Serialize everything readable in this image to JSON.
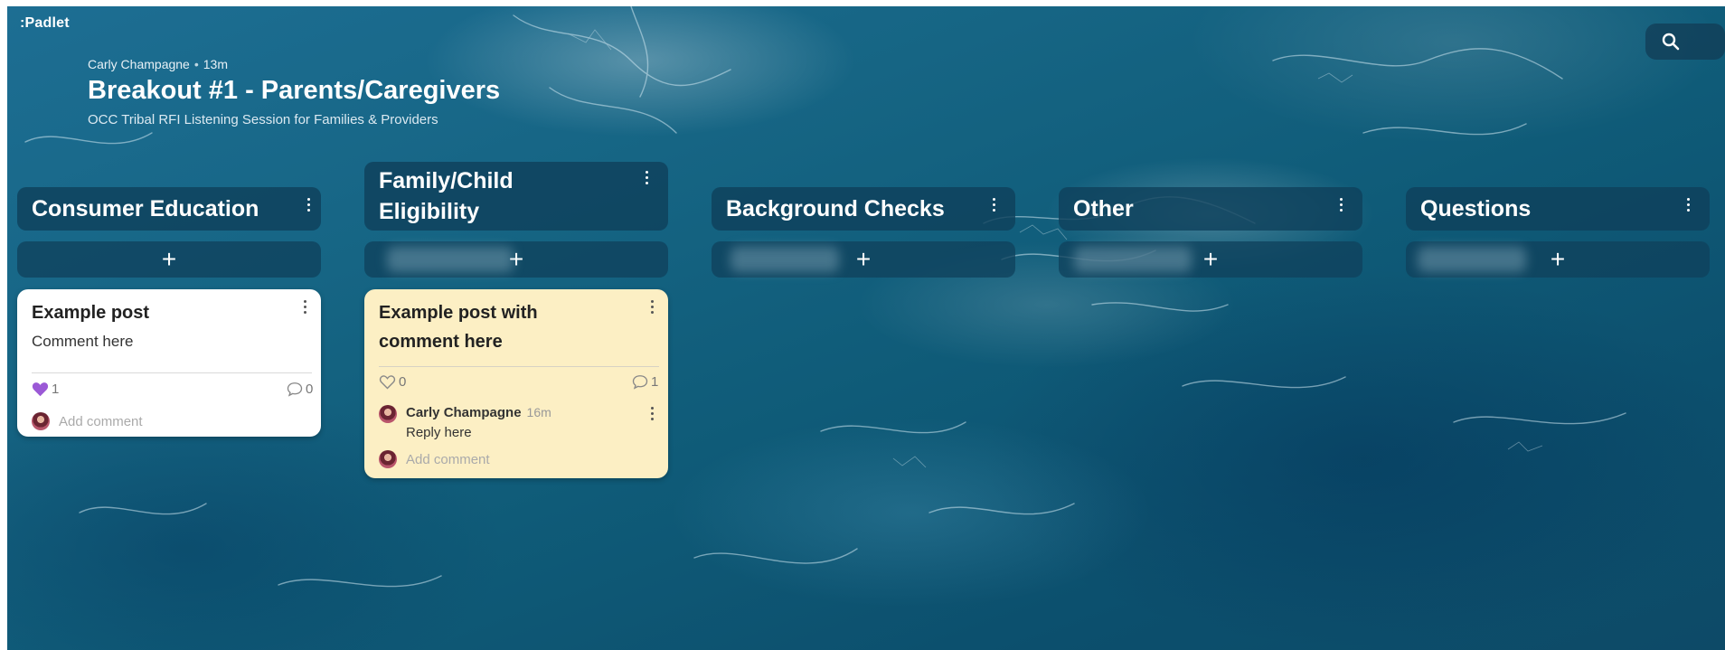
{
  "app": {
    "logo": ":Padlet"
  },
  "header": {
    "author": "Carly Champagne",
    "dot": "•",
    "time": "13m",
    "title": "Breakout #1 - Parents/Caregivers",
    "subtitle": "OCC Tribal RFI Listening Session for Families & Providers"
  },
  "sections": [
    {
      "label": "Consumer Education",
      "add_label": "+"
    },
    {
      "label_line1": "Family/Child",
      "label_line2": "Eligibility",
      "add_label": "+"
    },
    {
      "label": "Background Checks",
      "add_label": "+"
    },
    {
      "label": "Other",
      "add_label": "+"
    },
    {
      "label": "Questions",
      "add_label": "+"
    }
  ],
  "posts": [
    {
      "title": "Example post",
      "body": "Comment here",
      "likes": "1",
      "comments": "0",
      "add_comment": "Add comment",
      "color": "#ffffff"
    },
    {
      "title": "Example post with comment here",
      "likes": "0",
      "comments": "1",
      "reply_author": "Carly Champagne",
      "reply_time": "16m",
      "reply_text": "Reply here",
      "add_comment": "Add comment",
      "color": "#fcefc4"
    }
  ],
  "colors": {
    "accent_like": "#9b59d6",
    "section_bg": "#0f415c"
  },
  "icons": {
    "search": "search-icon",
    "kebab": "more-vertical-icon",
    "heart": "heart-icon",
    "comment": "comment-icon"
  }
}
